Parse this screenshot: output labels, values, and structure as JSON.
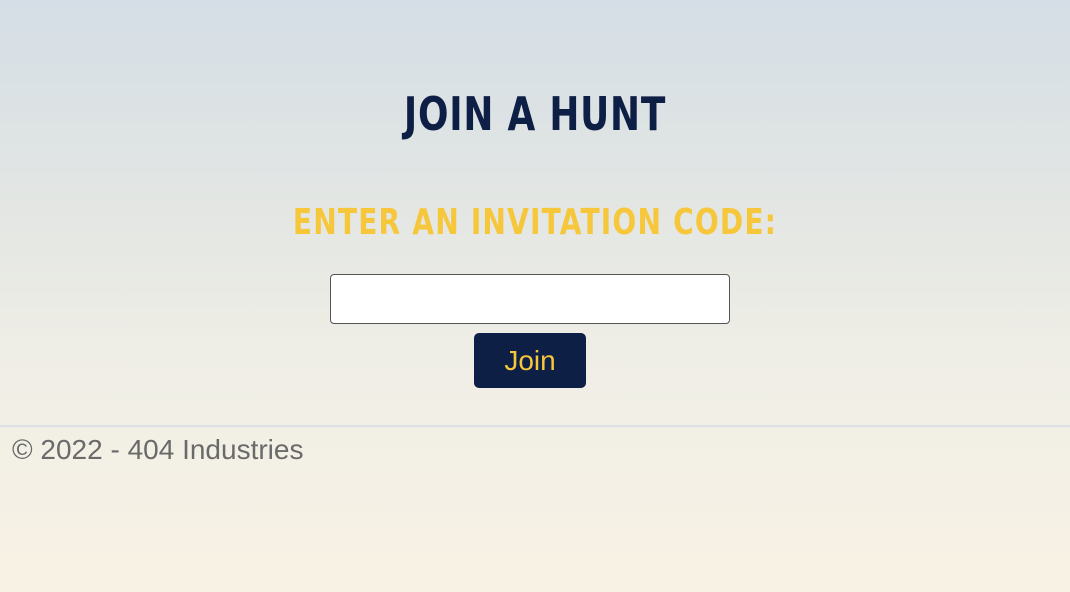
{
  "page": {
    "title": "Join a Hunt",
    "subtitle": "Enter an invitation code:"
  },
  "form": {
    "code_value": "",
    "code_placeholder": "",
    "join_label": "Join"
  },
  "footer": {
    "copyright": "© 2022 - 404 Industries"
  },
  "colors": {
    "navy": "#0e1f45",
    "gold": "#f6c63b",
    "footer_text": "#6a6a6a"
  }
}
